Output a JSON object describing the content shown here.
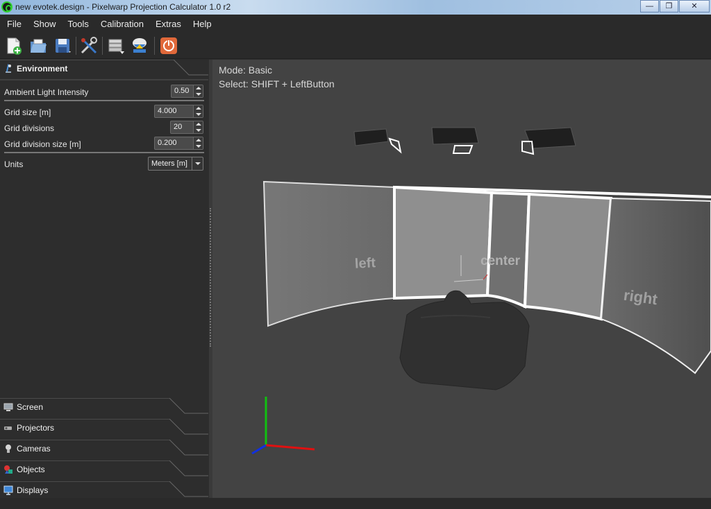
{
  "window": {
    "title": "new evotek.design - Pixelwarp Projection Calculator 1.0 r2",
    "minimize": "—",
    "maximize": "❐",
    "close": "✕"
  },
  "menu": [
    "File",
    "Show",
    "Tools",
    "Calibration",
    "Extras",
    "Help"
  ],
  "toolbar": {
    "icons": [
      "new-file-icon",
      "open-folder-icon",
      "save-icon",
      "tools-icon",
      "database-icon",
      "export-icon",
      "power-icon"
    ]
  },
  "environment": {
    "title": "Environment",
    "ambient_label": "Ambient Light Intensity",
    "ambient_value": "0.50",
    "grid_size_label": "Grid size  [m]",
    "grid_size_value": "4.000",
    "grid_divisions_label": "Grid divisions",
    "grid_divisions_value": "20",
    "grid_division_size_label": "Grid division size  [m]",
    "grid_division_size_value": "0.200",
    "units_label": "Units",
    "units_value": "Meters [m]"
  },
  "sections": [
    "Screen",
    "Projectors",
    "Cameras",
    "Objects",
    "Displays"
  ],
  "viewport": {
    "mode": "Mode: Basic",
    "select": "Select: SHIFT + LeftButton",
    "screen_labels": {
      "left": "left",
      "center": "center",
      "right": "right"
    }
  },
  "colors": {
    "x_axis": "#e01010",
    "y_axis": "#10c010",
    "z_axis": "#1030e0",
    "accent_icon": "#e06a3a"
  }
}
